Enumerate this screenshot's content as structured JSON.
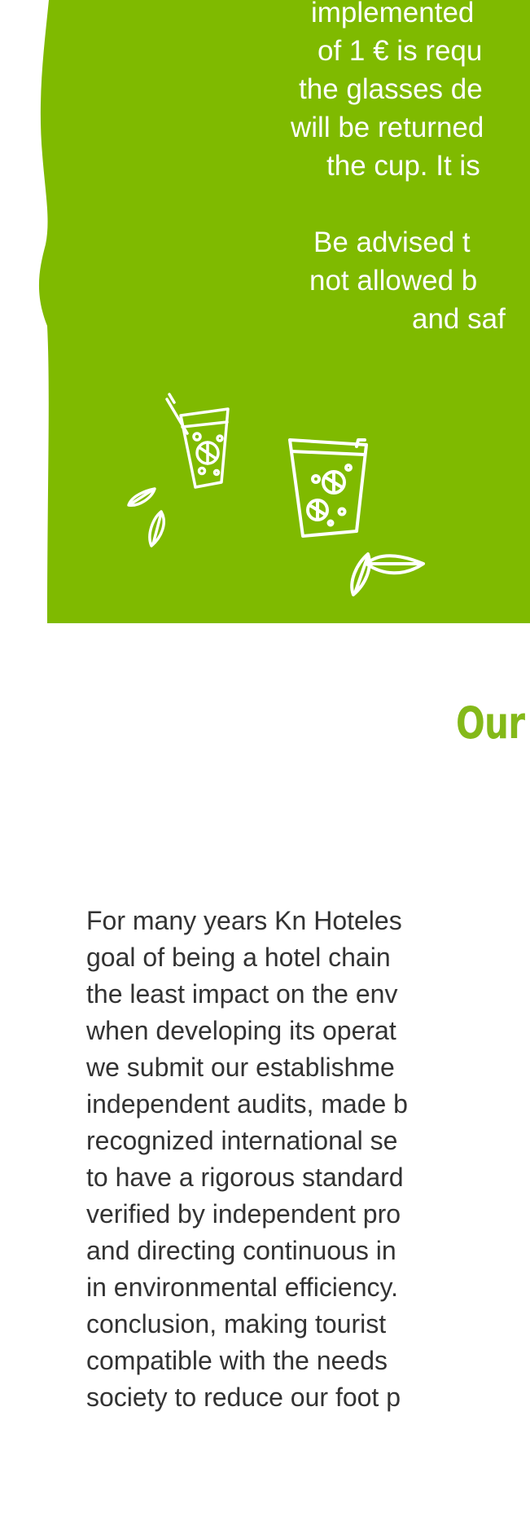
{
  "colors": {
    "panel_green": "#7fba00",
    "title_green": "#84b919",
    "body_text": "#333333",
    "panel_text": "#ffffff"
  },
  "panel": {
    "paragraph1": [
      "implemented",
      "of 1 € is requ",
      "the glasses de",
      "will be returned",
      "the cup. It is"
    ],
    "paragraph2": [
      "Be advised t",
      "not allowed b",
      "and saf"
    ],
    "icons": [
      "drink-glass-straw-icon",
      "drink-glass-icon",
      "leaf-icon"
    ]
  },
  "section": {
    "title": "Our"
  },
  "body": {
    "lines": [
      "For many years Kn Hoteles",
      "goal of being a hotel chain",
      "the least impact on the env",
      "when developing its operat",
      "we submit our establishme",
      "independent audits, made b",
      "recognized international se",
      "to have a rigorous standard",
      "verified by independent pro",
      "and directing continuous in",
      "in environmental efficiency.",
      "conclusion, making tourist",
      "compatible with the needs",
      "society to reduce our foot p"
    ]
  }
}
